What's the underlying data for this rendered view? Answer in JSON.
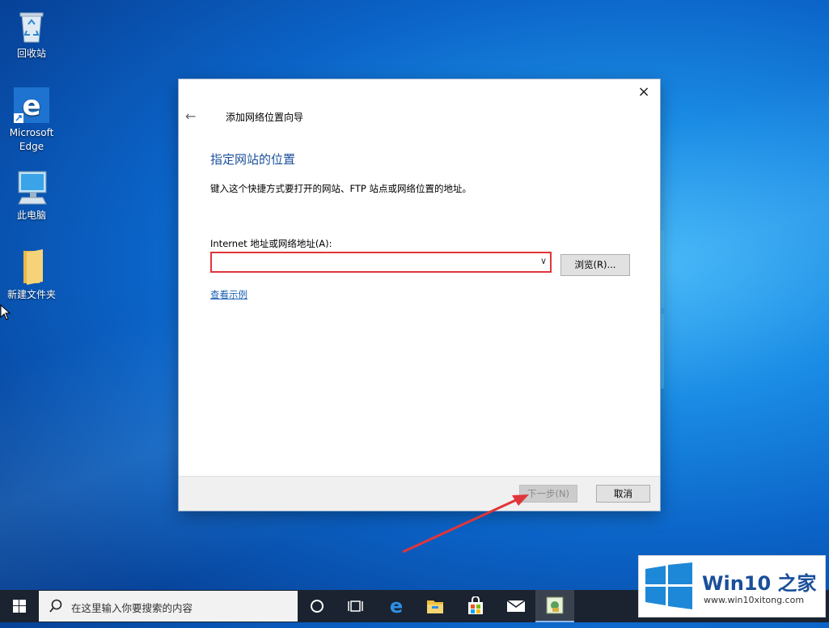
{
  "desktop": {
    "icons": [
      {
        "label": "回收站"
      },
      {
        "label": "Microsoft Edge"
      },
      {
        "label": "此电脑"
      },
      {
        "label": "新建文件夹"
      }
    ]
  },
  "dialog": {
    "close_icon": "×",
    "back_icon": "←",
    "title": "添加网络位置向导",
    "heading": "指定网站的位置",
    "description": "键入这个快捷方式要打开的网站、FTP 站点或网络位置的地址。",
    "address_label": "Internet 地址或网络地址(A):",
    "address_value": "",
    "browse_label": "浏览(R)...",
    "example_link": "查看示例",
    "next_label": "下一步(N)",
    "cancel_label": "取消",
    "highlight_color": "#e0353b"
  },
  "taskbar": {
    "search_placeholder": "在这里输入你要搜索的内容",
    "icons": [
      "windows-start-icon",
      "cortana-icon",
      "task-view-icon",
      "edge-icon",
      "file-explorer-icon",
      "store-icon",
      "mail-icon",
      "control-panel-icon"
    ]
  },
  "watermark": {
    "brand": "Win10 之家",
    "url": "www.win10xitong.com"
  }
}
